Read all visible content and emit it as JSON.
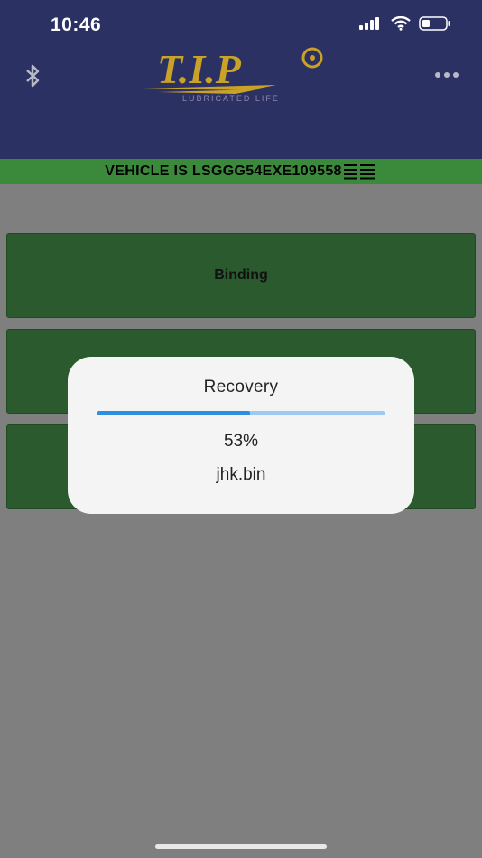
{
  "status_bar": {
    "time": "10:46"
  },
  "logo": {
    "text": "T.I.P",
    "tagline": "LUBRICATED LIFE"
  },
  "header": {
    "vehicle_text": "VEHICLE IS LSGGG54EXE109558"
  },
  "menu": {
    "items": [
      {
        "label": "Binding"
      },
      {
        "label": ""
      },
      {
        "label": ""
      }
    ]
  },
  "dialog": {
    "title": "Recovery",
    "progress_percent": 53,
    "percent_text": "53%",
    "file_name": "jhk.bin"
  },
  "colors": {
    "header_bg": "#2c3164",
    "vehicle_bar": "#3b8a3c",
    "button_bg": "#2a5a2d",
    "progress_fill": "#2e8fe0",
    "progress_track": "#9dcaf0",
    "logo_gold": "#c9a227"
  },
  "icons": [
    "signal-icon",
    "wifi-icon",
    "battery-icon",
    "bluetooth-icon",
    "more-icon",
    "barcode-icon"
  ]
}
